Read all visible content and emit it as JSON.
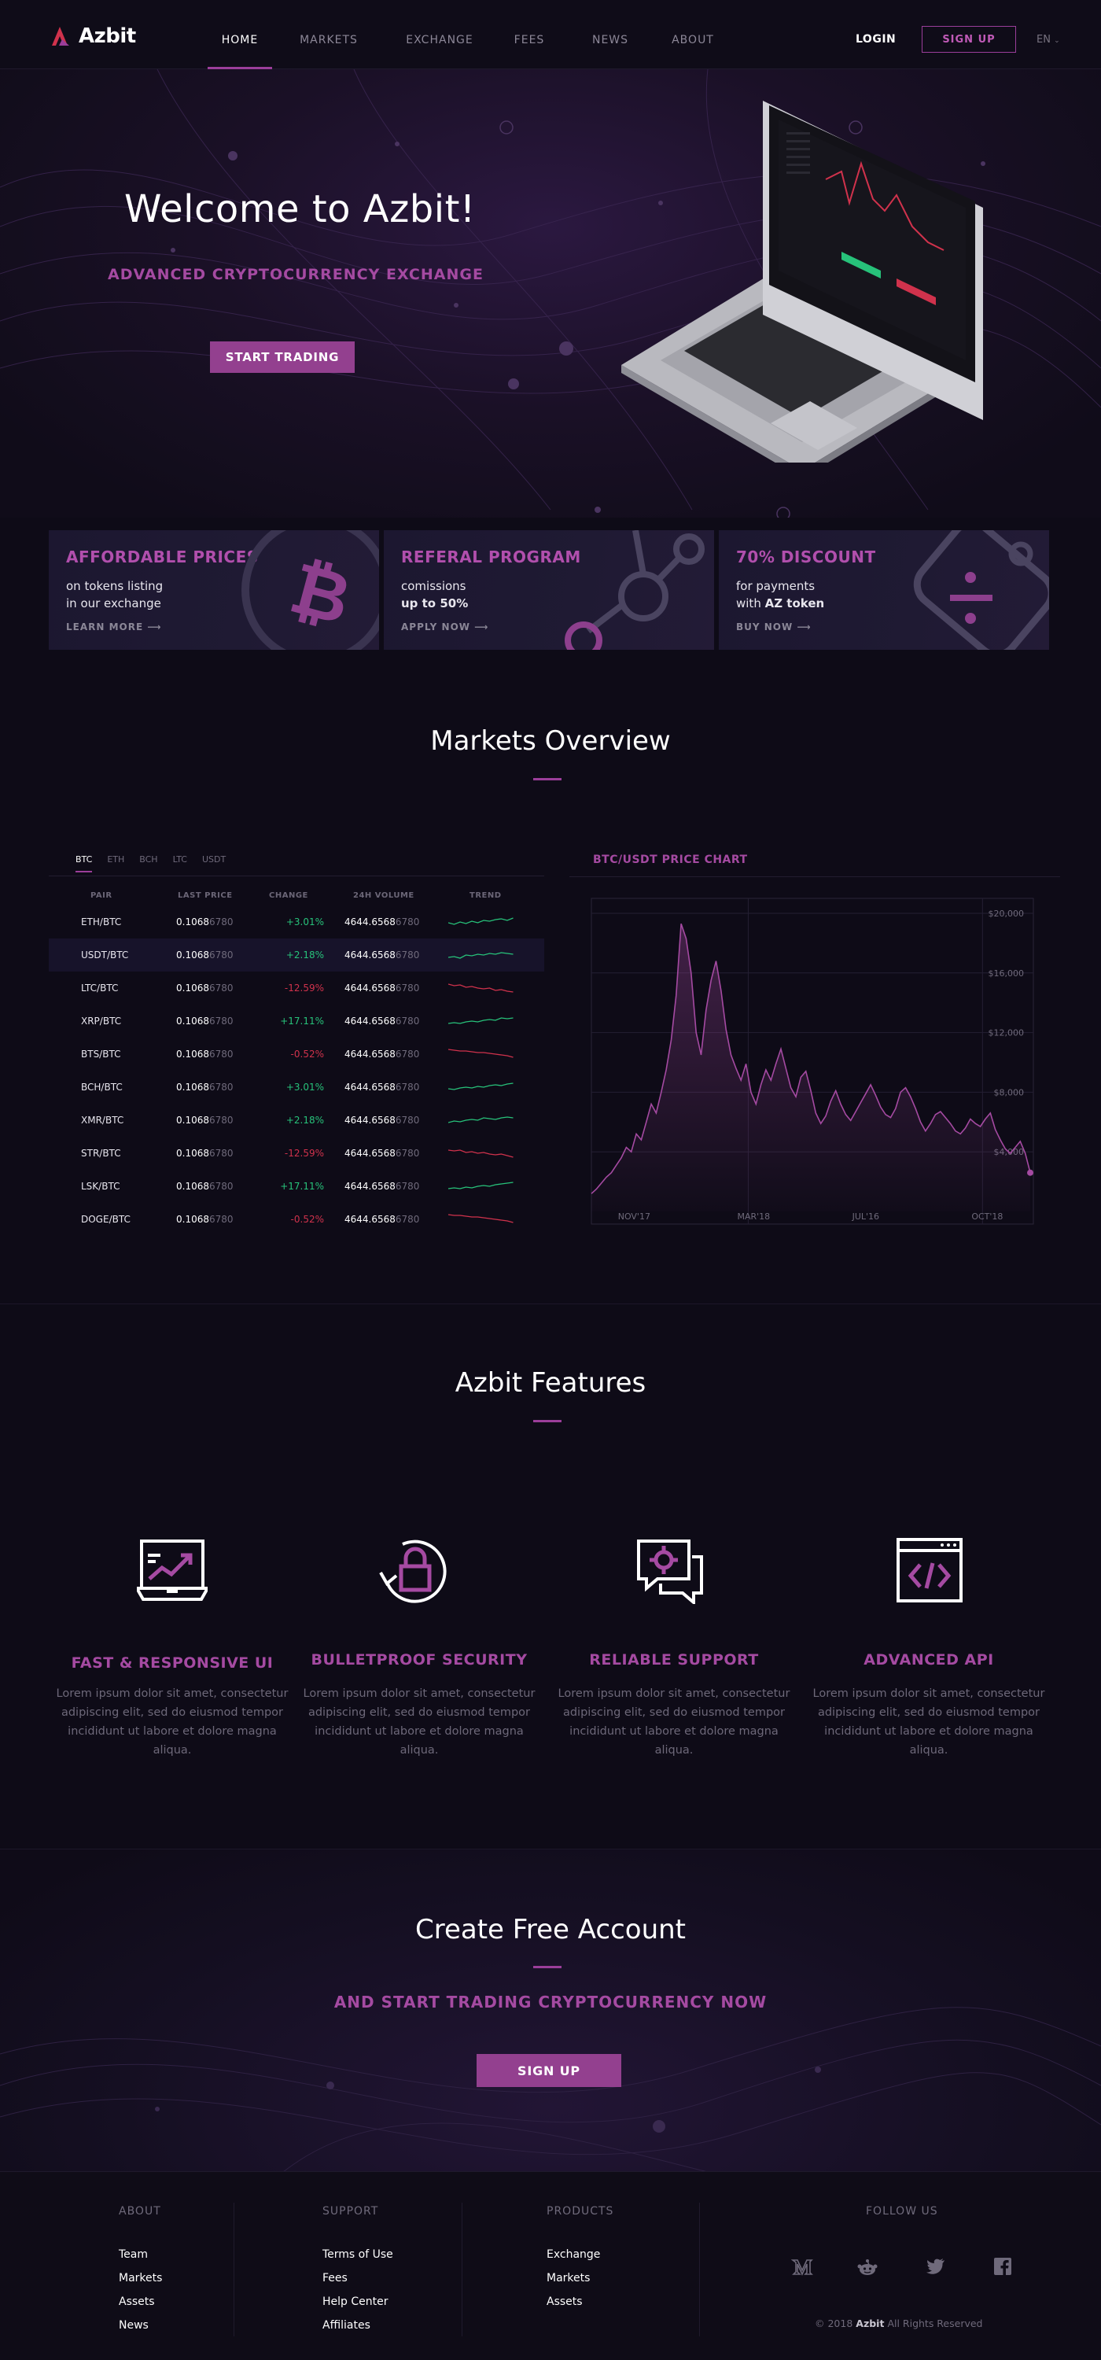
{
  "nav": {
    "brand": "Azbit",
    "links": [
      "HOME",
      "MARKETS",
      "EXCHANGE",
      "FEES",
      "NEWS",
      "ABOUT"
    ],
    "active": "HOME",
    "login": "LOGIN",
    "signup": "SIGN UP",
    "language": "EN"
  },
  "hero": {
    "title": "Welcome to Azbit!",
    "subtitle": "ADVANCED CRYPTOCURRENCY EXCHANGE",
    "cta": "START TRADING"
  },
  "promos": [
    {
      "title": "AFFORDABLE PRICES",
      "line1": "on tokens listing",
      "line2": "in our exchange",
      "link": "LEARN MORE",
      "icon": "bitcoin-icon"
    },
    {
      "title": "REFERAL PROGRAM",
      "line1": "comissions",
      "line2": "up to 50%",
      "link": "APPLY NOW",
      "icon": "network-icon"
    },
    {
      "title": "70% DISCOUNT",
      "line1": "for payments",
      "line2_prefix": "with ",
      "line2_bold": "AZ token",
      "link": "BUY NOW",
      "icon": "percent-tag-icon"
    }
  ],
  "markets": {
    "title": "Markets Overview",
    "tabs": [
      "BTC",
      "ETH",
      "BCH",
      "LTC",
      "USDT"
    ],
    "active_tab": "BTC",
    "columns": [
      "PAIR",
      "LAST PRICE",
      "CHANGE",
      "24H VOLUME",
      "TREND"
    ],
    "rows": [
      {
        "pair": "ETH/BTC",
        "last_main": "0.1068",
        "last_dim": "6780",
        "change": "+3.01%",
        "dir": "up",
        "vol_main": "4644.6568",
        "vol_dim": "6780"
      },
      {
        "pair": "USDT/BTC",
        "last_main": "0.1068",
        "last_dim": "6780",
        "change": "+2.18%",
        "dir": "up",
        "vol_main": "4644.6568",
        "vol_dim": "6780"
      },
      {
        "pair": "LTC/BTC",
        "last_main": "0.1068",
        "last_dim": "6780",
        "change": "-12.59%",
        "dir": "down",
        "vol_main": "4644.6568",
        "vol_dim": "6780"
      },
      {
        "pair": "XRP/BTC",
        "last_main": "0.1068",
        "last_dim": "6780",
        "change": "+17.11%",
        "dir": "up",
        "vol_main": "4644.6568",
        "vol_dim": "6780"
      },
      {
        "pair": "BTS/BTC",
        "last_main": "0.1068",
        "last_dim": "6780",
        "change": "-0.52%",
        "dir": "down",
        "vol_main": "4644.6568",
        "vol_dim": "6780"
      },
      {
        "pair": "BCH/BTC",
        "last_main": "0.1068",
        "last_dim": "6780",
        "change": "+3.01%",
        "dir": "up",
        "vol_main": "4644.6568",
        "vol_dim": "6780"
      },
      {
        "pair": "XMR/BTC",
        "last_main": "0.1068",
        "last_dim": "6780",
        "change": "+2.18%",
        "dir": "up",
        "vol_main": "4644.6568",
        "vol_dim": "6780"
      },
      {
        "pair": "STR/BTC",
        "last_main": "0.1068",
        "last_dim": "6780",
        "change": "-12.59%",
        "dir": "down",
        "vol_main": "4644.6568",
        "vol_dim": "6780"
      },
      {
        "pair": "LSK/BTC",
        "last_main": "0.1068",
        "last_dim": "6780",
        "change": "+17.11%",
        "dir": "up",
        "vol_main": "4644.6568",
        "vol_dim": "6780"
      },
      {
        "pair": "DOGE/BTC",
        "last_main": "0.1068",
        "last_dim": "6780",
        "change": "-0.52%",
        "dir": "down",
        "vol_main": "4644.6568",
        "vol_dim": "6780"
      }
    ],
    "chart_title": "BTC/USDT PRICE CHART"
  },
  "chart_data": {
    "type": "area",
    "title": "BTC/USDT PRICE CHART",
    "x_ticks": [
      "NOV'17",
      "MAR'18",
      "JUL'16",
      "OCT'18"
    ],
    "y_ticks": [
      "$20,000",
      "$16,000",
      "$12,000",
      "$8,000",
      "$4,000"
    ],
    "ylim": [
      0,
      21000
    ],
    "grid": true,
    "values": [
      1200,
      1500,
      1900,
      2300,
      2600,
      3100,
      3600,
      4300,
      4000,
      5200,
      4800,
      6000,
      7200,
      6600,
      8000,
      9500,
      11500,
      14500,
      19300,
      18300,
      16000,
      12000,
      10500,
      13500,
      15500,
      16800,
      14800,
      12200,
      10500,
      9600,
      8800,
      9900,
      8000,
      7200,
      8500,
      9500,
      8800,
      9900,
      10900,
      9600,
      8300,
      7700,
      9000,
      9400,
      8100,
      6600,
      5900,
      6400,
      7400,
      8100,
      7200,
      6500,
      6100,
      6700,
      7300,
      7900,
      8500,
      7800,
      7000,
      6500,
      6300,
      6900,
      8000,
      8300,
      7700,
      6900,
      6000,
      5400,
      5900,
      6500,
      6700,
      6300,
      5900,
      5400,
      5200,
      5600,
      6200,
      5900,
      5700,
      6200,
      6600,
      5500,
      4800,
      4200,
      3900,
      4300,
      4700,
      3900,
      2600
    ],
    "color": "#a54aa2"
  },
  "features": {
    "title": "Azbit Features",
    "items": [
      {
        "title": "FAST & RESPONSIVE UI",
        "text": "Lorem ipsum dolor sit amet, consectetur adipiscing elit, sed do eiusmod tempor incididunt ut labore et dolore magna aliqua.",
        "icon": "laptop-chart-icon"
      },
      {
        "title": "BULLETPROOF SECURITY",
        "text": "Lorem ipsum dolor sit amet, consectetur adipiscing elit, sed do eiusmod tempor incididunt ut labore et dolore magna aliqua.",
        "icon": "lock-refresh-icon"
      },
      {
        "title": "RELIABLE SUPPORT",
        "text": "Lorem ipsum dolor sit amet, consectetur adipiscing elit, sed do eiusmod tempor incididunt ut labore et dolore magna aliqua.",
        "icon": "chat-gear-icon"
      },
      {
        "title": "ADVANCED API",
        "text": "Lorem ipsum dolor sit amet, consectetur adipiscing elit, sed do eiusmod tempor incididunt ut labore et dolore magna aliqua.",
        "icon": "code-window-icon"
      }
    ]
  },
  "cta": {
    "title": "Create Free Account",
    "subtitle": "AND START TRADING CRYPTOCURRENCY NOW",
    "button": "SIGN UP"
  },
  "footer": {
    "about": {
      "title": "ABOUT",
      "links": [
        "Team",
        "Markets",
        "Assets",
        "News"
      ]
    },
    "support": {
      "title": "SUPPORT",
      "links": [
        "Terms of Use",
        "Fees",
        "Help Center",
        "Affiliates"
      ]
    },
    "products": {
      "title": "PRODUCTS",
      "links": [
        "Exchange",
        "Markets",
        "Assets"
      ]
    },
    "follow_title": "FOLLOW US",
    "social": [
      "medium-icon",
      "reddit-icon",
      "twitter-icon",
      "facebook-icon"
    ],
    "copyright_prefix": "© 2018",
    "copyright_brand": "Azbit",
    "copyright_suffix": "All Rights Reserved"
  },
  "colors": {
    "accent": "#9b3e9a",
    "accent_text": "#a54aa2",
    "positive": "#27c27a",
    "negative": "#d0324c",
    "background": "#0e0b17"
  }
}
